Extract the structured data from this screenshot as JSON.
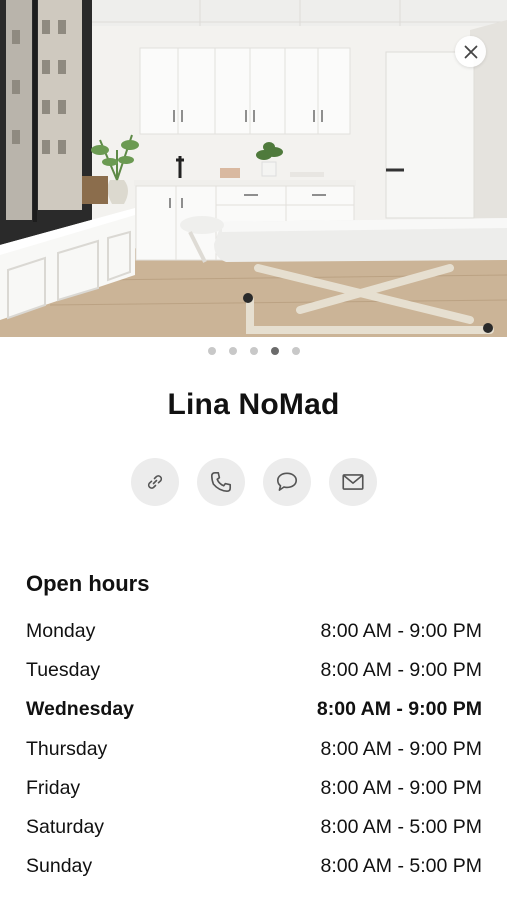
{
  "gallery": {
    "image_alt": "Treatment room with massage table",
    "page_count": 5,
    "active_page": 4
  },
  "close_icon": "close-icon",
  "place": {
    "name": "Lina NoMad"
  },
  "actions": [
    {
      "icon": "link-icon"
    },
    {
      "icon": "phone-icon"
    },
    {
      "icon": "message-icon"
    },
    {
      "icon": "mail-icon"
    }
  ],
  "hours": {
    "title": "Open hours",
    "today_index": 2,
    "rows": [
      {
        "day": "Monday",
        "time": "8:00 AM - 9:00 PM"
      },
      {
        "day": "Tuesday",
        "time": "8:00 AM - 9:00 PM"
      },
      {
        "day": "Wednesday",
        "time": "8:00 AM - 9:00 PM"
      },
      {
        "day": "Thursday",
        "time": "8:00 AM - 9:00 PM"
      },
      {
        "day": "Friday",
        "time": "8:00 AM - 9:00 PM"
      },
      {
        "day": "Saturday",
        "time": "8:00 AM - 5:00 PM"
      },
      {
        "day": "Sunday",
        "time": "8:00 AM - 5:00 PM"
      }
    ]
  },
  "colors": {
    "button_bg": "#ececec",
    "dot_inactive": "#c8c8c8",
    "dot_active": "#6b6b6b",
    "icon_stroke": "#555555"
  }
}
